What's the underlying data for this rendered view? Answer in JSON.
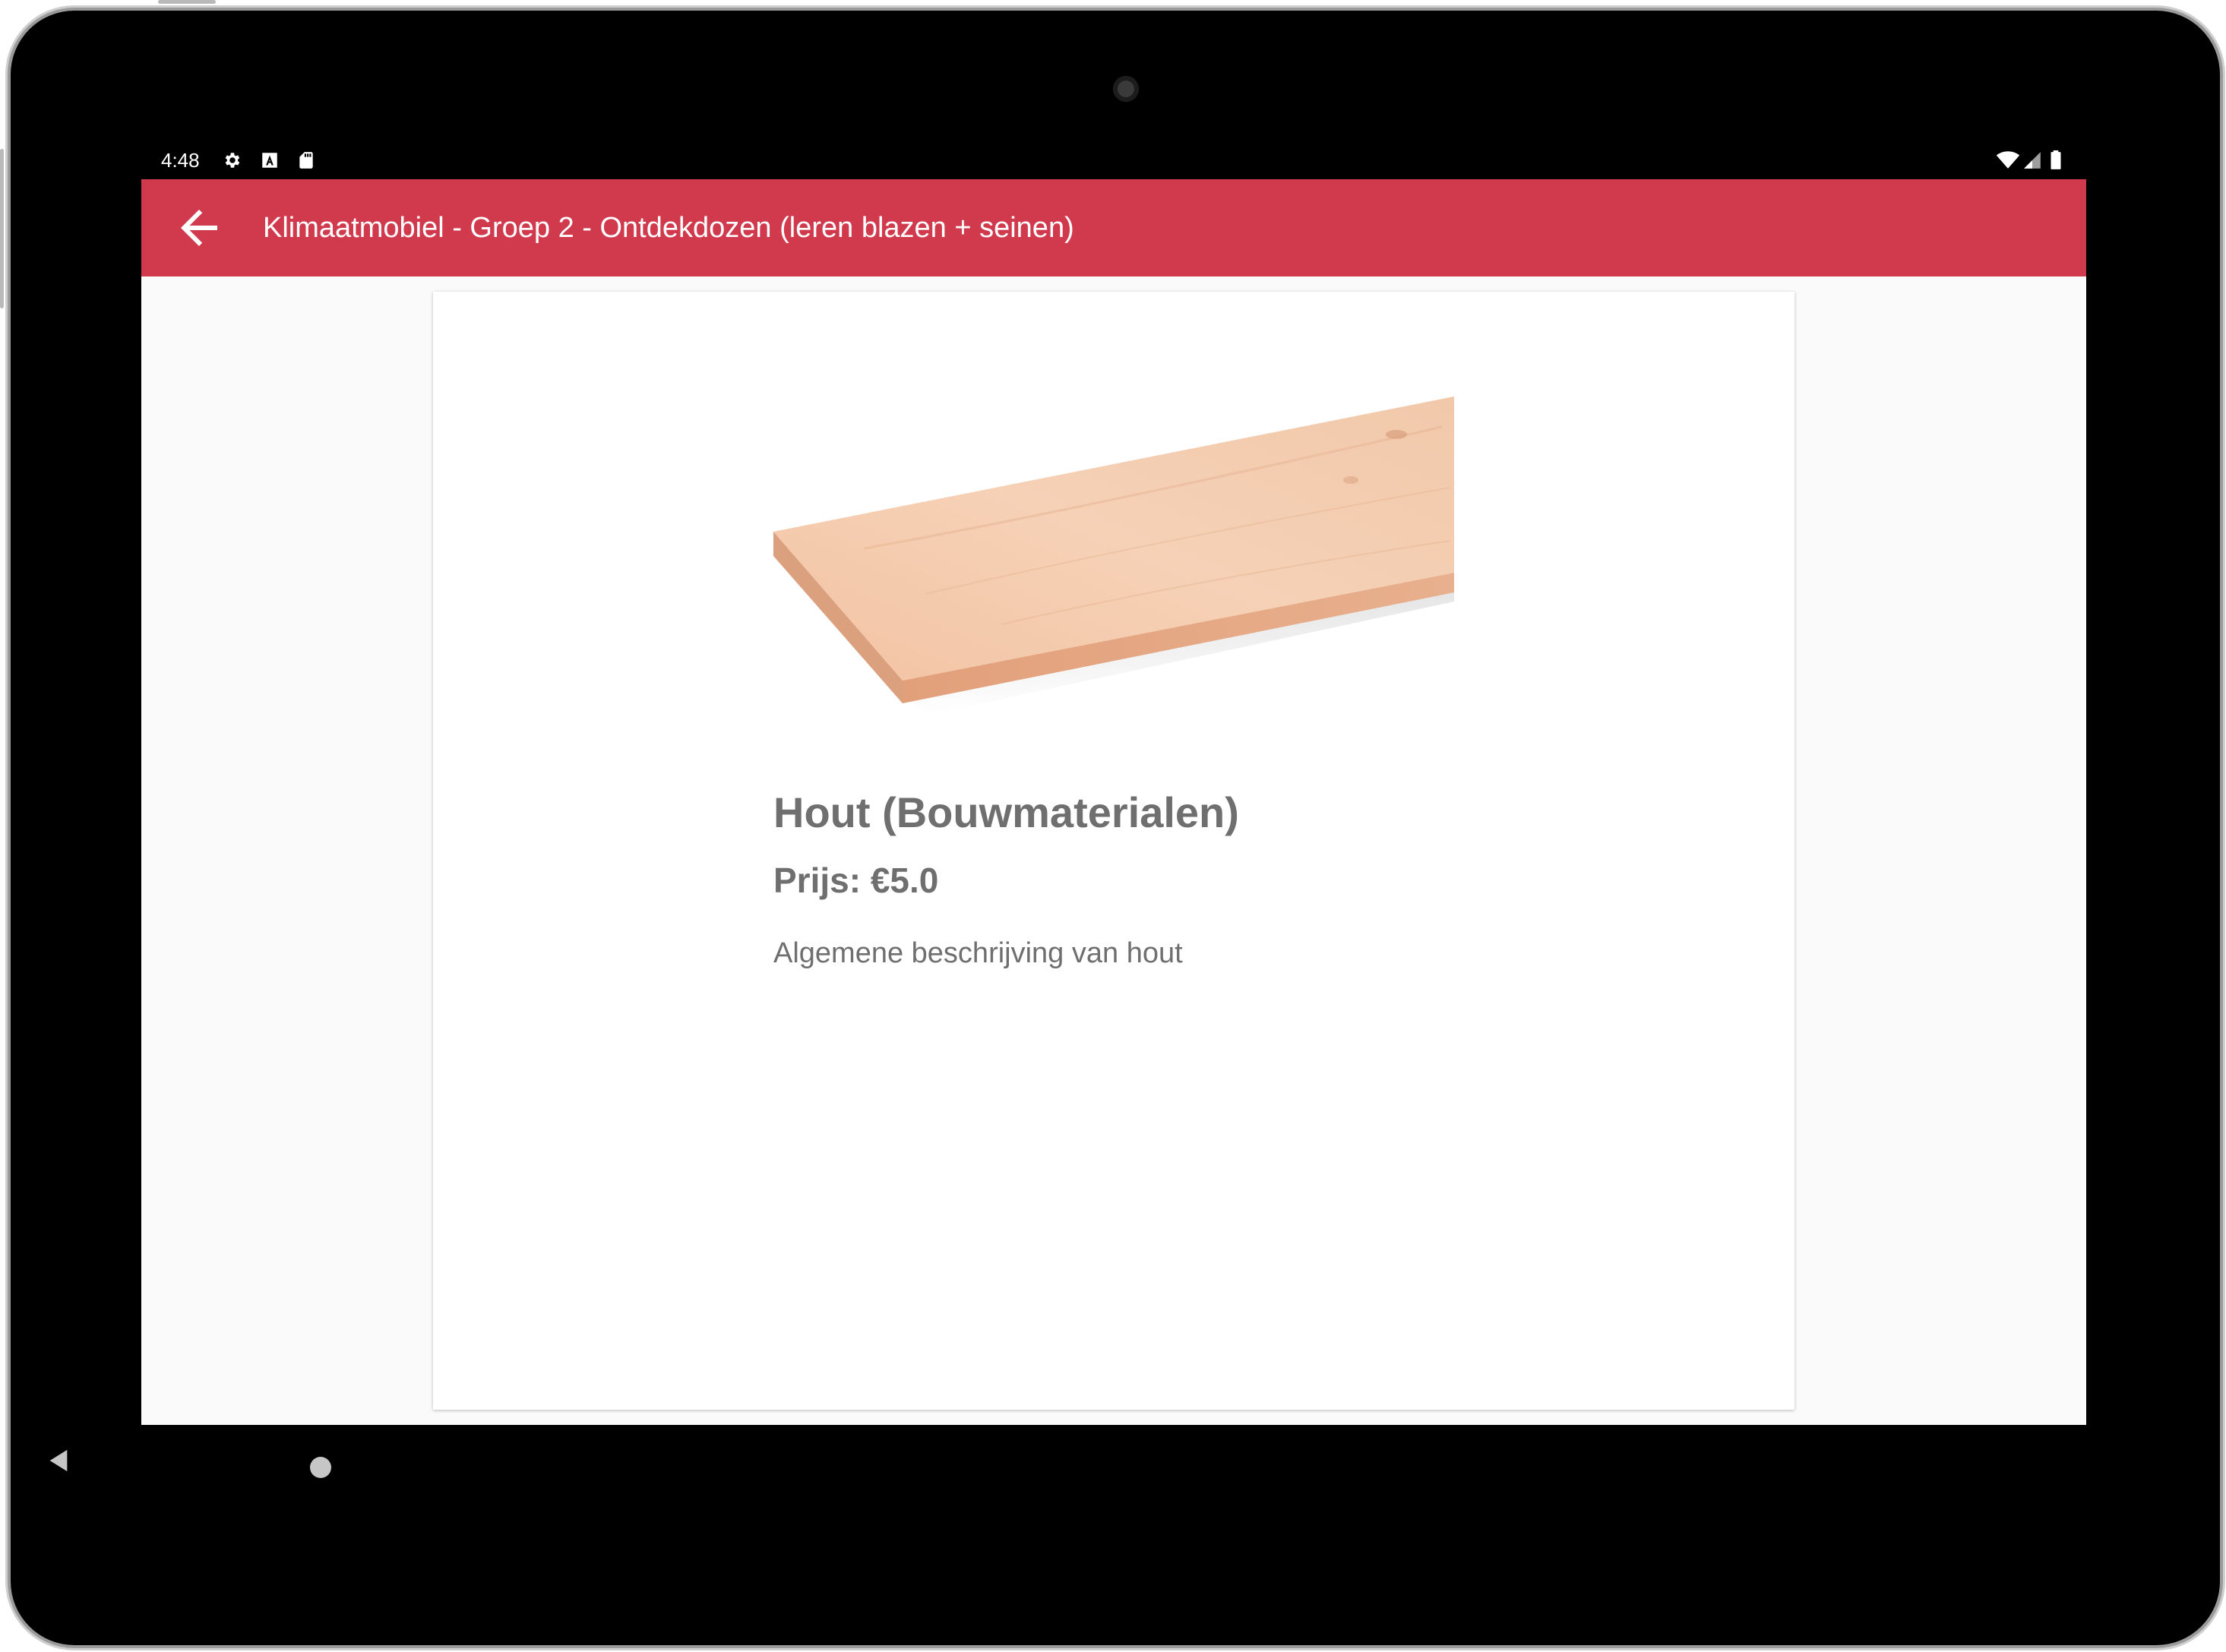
{
  "status_bar": {
    "time": "4:48",
    "left_icons": [
      "gear-icon",
      "font-a-icon",
      "sd-card-icon"
    ],
    "right_icons": [
      "wifi-icon",
      "signal-icon",
      "battery-icon"
    ]
  },
  "app_bar": {
    "title": "Klimaatmobiel - Groep 2 - Ontdekdozen (leren blazen + seinen)",
    "back_icon": "arrow-left-icon",
    "color": "#d1394d"
  },
  "product": {
    "image_label": "wooden-plank-image",
    "title": "Hout (Bouwmaterialen)",
    "price": "Prijs: €5.0",
    "description": "Algemene beschrijving van hout"
  },
  "nav_bar": {
    "back_icon": "triangle-back-icon",
    "home_icon": "circle-home-icon"
  }
}
